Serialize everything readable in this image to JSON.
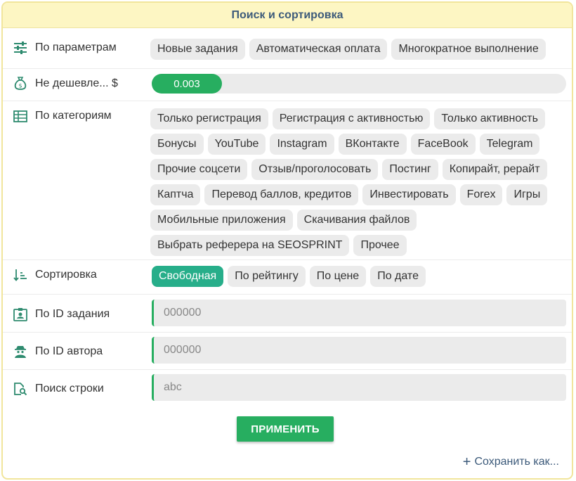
{
  "header": {
    "title": "Поиск и сортировка"
  },
  "params": {
    "label": "По параметрам",
    "chips": [
      "Новые задания",
      "Автоматическая оплата",
      "Многократное выполнение"
    ]
  },
  "price": {
    "label": "Не дешевле... $",
    "value": "0.003"
  },
  "categories": {
    "label": "По категориям",
    "chips": [
      "Только регистрация",
      "Регистрация с активностью",
      "Только активность",
      "Бонусы",
      "YouTube",
      "Instagram",
      "ВКонтакте",
      "FaceBook",
      "Telegram",
      "Прочие соцсети",
      "Отзыв/проголосовать",
      "Постинг",
      "Копирайт, рерайт",
      "Каптча",
      "Перевод баллов, кредитов",
      "Инвестировать",
      "Forex",
      "Игры",
      "Мобильные приложения",
      "Скачивания файлов",
      "Выбрать реферера на SEOSPRINT",
      "Прочее"
    ]
  },
  "sort": {
    "label": "Сортировка",
    "options": [
      "Свободная",
      "По рейтингу",
      "По цене",
      "По дате"
    ],
    "active_index": 0
  },
  "task_id": {
    "label": "По ID задания",
    "placeholder": "000000"
  },
  "author_id": {
    "label": "По ID автора",
    "placeholder": "000000"
  },
  "search": {
    "label": "Поиск строки",
    "placeholder": "abc"
  },
  "apply_label": "ПРИМЕНИТЬ",
  "save_as": {
    "plus": "+",
    "label": "Сохранить как..."
  },
  "colors": {
    "accent": "#27ae60",
    "active_chip": "#27ae8a",
    "header_bg": "#fdf6c3",
    "icon": "#2e8b6f"
  }
}
